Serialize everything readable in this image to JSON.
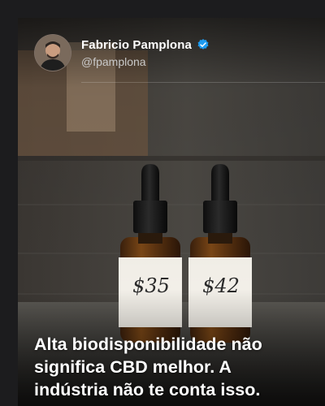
{
  "post": {
    "author": {
      "name": "Fabricio Pamplona",
      "handle": "@fpamplona",
      "verified_badge_color": "#1d9bf0",
      "verified_icon": "verified-badge-icon"
    },
    "image": {
      "left_bottle_price": "$35",
      "right_bottle_price": "$42"
    },
    "headline_lines": [
      "Alta biodisponibilidade não",
      "significa CBD melhor. A",
      "indústria não te conta isso."
    ]
  }
}
